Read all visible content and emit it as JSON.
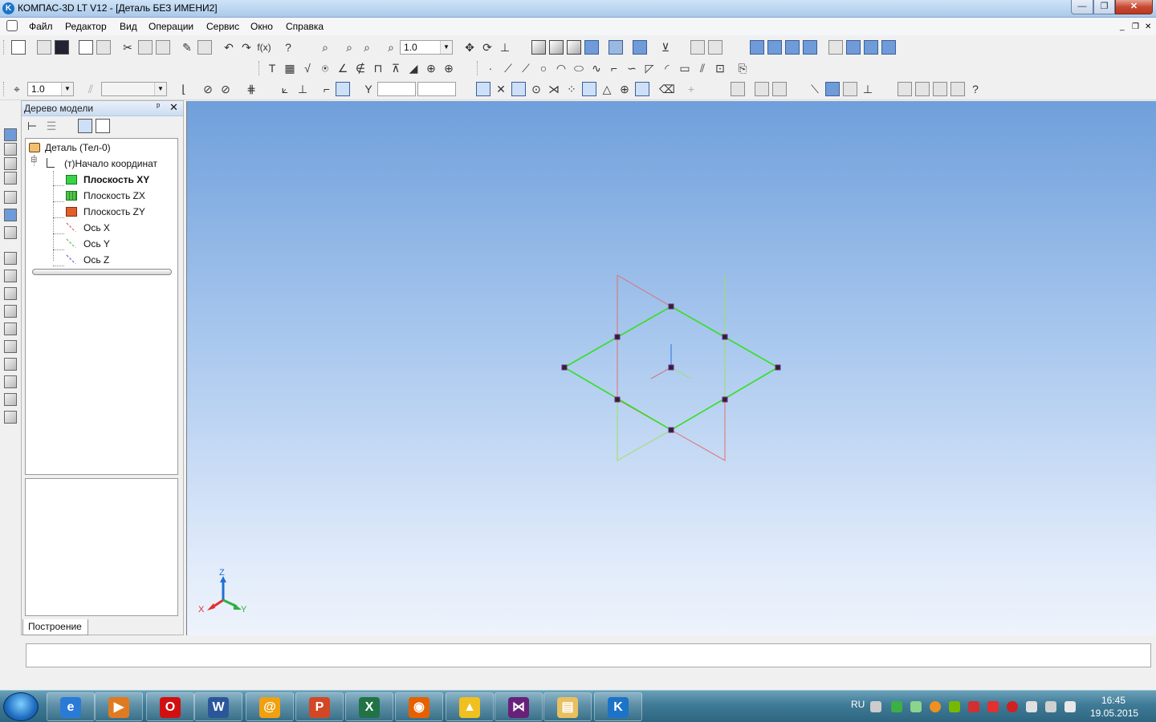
{
  "window": {
    "title": "КОМПАС-3D LT V12 - [Деталь БЕЗ ИМЕНИ2]",
    "app_icon": "kompas-logo-icon",
    "controls": {
      "minimize": "—",
      "maximize": "❐",
      "close": "✕"
    }
  },
  "menu": {
    "items": [
      "Файл",
      "Редактор",
      "Вид",
      "Операции",
      "Сервис",
      "Окно",
      "Справка"
    ],
    "mdi": {
      "minimize": "_",
      "restore": "❐",
      "close": "✕"
    }
  },
  "toolbars": {
    "scale_value": "1.0",
    "step_value": "1.0"
  },
  "model_tree": {
    "title": "Дерево модели",
    "pin": "ᵖ",
    "close": "✕",
    "nodes": [
      {
        "label": "Деталь (Тел-0)",
        "icon": "part-icon",
        "bold": false
      },
      {
        "label": "(т)Начало координат",
        "icon": "origin-icon",
        "bold": false
      },
      {
        "label": "Плоскость XY",
        "icon": "plane-xy-icon",
        "bold": true,
        "color": "#39d24a"
      },
      {
        "label": "Плоскость ZX",
        "icon": "plane-zx-icon",
        "bold": false,
        "color": "#52c24a"
      },
      {
        "label": "Плоскость ZY",
        "icon": "plane-zy-icon",
        "bold": false,
        "color": "#e0602a"
      },
      {
        "label": "Ось X",
        "icon": "axis-x-icon",
        "bold": false,
        "color": "#e04040"
      },
      {
        "label": "Ось Y",
        "icon": "axis-y-icon",
        "bold": false,
        "color": "#40b040"
      },
      {
        "label": "Ось Z",
        "icon": "axis-z-icon",
        "bold": false,
        "color": "#7040c0"
      }
    ],
    "tab": "Построение"
  },
  "viewport": {
    "background_top": "#6f9fdb",
    "background_bottom": "#eef3fb",
    "sketch_color": "#33e020",
    "plane_zx_color": "#e06a6a",
    "plane_zy_color": "#9ce060",
    "triad": {
      "x": "X",
      "y": "Y",
      "z": "Z"
    }
  },
  "taskbar": {
    "apps": [
      {
        "name": "internet-explorer-icon",
        "glyph": "e",
        "color": "#2a7ad6"
      },
      {
        "name": "media-player-icon",
        "glyph": "▶",
        "color": "#e07a20"
      },
      {
        "name": "opera-icon",
        "glyph": "O",
        "color": "#d01010"
      },
      {
        "name": "word-icon",
        "glyph": "W",
        "color": "#2b579a"
      },
      {
        "name": "mail-agent-icon",
        "glyph": "@",
        "color": "#f0a010"
      },
      {
        "name": "powerpoint-icon",
        "glyph": "P",
        "color": "#d24726"
      },
      {
        "name": "excel-icon",
        "glyph": "X",
        "color": "#217346"
      },
      {
        "name": "firefox-icon",
        "glyph": "◉",
        "color": "#e66000"
      },
      {
        "name": "aimp-icon",
        "glyph": "▲",
        "color": "#f0c020"
      },
      {
        "name": "visual-studio-icon",
        "glyph": "⋈",
        "color": "#68217a"
      },
      {
        "name": "file-explorer-icon",
        "glyph": "▤",
        "color": "#e8c060"
      },
      {
        "name": "kompas-icon",
        "glyph": "K",
        "color": "#1c73c8"
      }
    ],
    "lang": "RU",
    "time": "16:45",
    "date": "19.05.2015"
  }
}
